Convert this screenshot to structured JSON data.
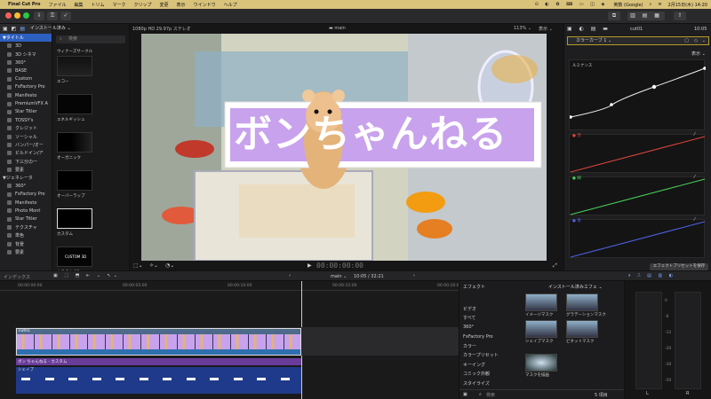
{
  "menubar": {
    "app": "Final Cut Pro",
    "items": [
      "ファイル",
      "編集",
      "トリム",
      "マーク",
      "クリップ",
      "変更",
      "表示",
      "ウインドウ",
      "ヘルプ"
    ],
    "right": {
      "input": "英数 (Google)",
      "datetime": "2月15日(木)  14:20"
    }
  },
  "sidebar": {
    "header": "インストール済み ⌄",
    "items": [
      {
        "label": "タイトル",
        "level": 0,
        "selected": true
      },
      {
        "label": "3D",
        "level": 1
      },
      {
        "label": "3D シネマ",
        "level": 1
      },
      {
        "label": "360°",
        "level": 1
      },
      {
        "label": "BASE",
        "level": 1
      },
      {
        "label": "Custom",
        "level": 1
      },
      {
        "label": "FxFactory Pro",
        "level": 1
      },
      {
        "label": "Manifesto",
        "level": 1
      },
      {
        "label": "PremiumVFX A",
        "level": 1
      },
      {
        "label": "Star Titler",
        "level": 1
      },
      {
        "label": "TOSSY's",
        "level": 1
      },
      {
        "label": "クレジット",
        "level": 1
      },
      {
        "label": "ソーシャル",
        "level": 1
      },
      {
        "label": "バンパー/オー",
        "level": 1
      },
      {
        "label": "ビルドイン/ア",
        "level": 1
      },
      {
        "label": "下三分の一",
        "level": 1
      },
      {
        "label": "要素",
        "level": 1
      },
      {
        "label": "ジェネレータ",
        "level": 0
      },
      {
        "label": "360°",
        "level": 1
      },
      {
        "label": "FxFactory Pro",
        "level": 1
      },
      {
        "label": "Manifesto",
        "level": 1
      },
      {
        "label": "Photo Mont",
        "level": 1
      },
      {
        "label": "Star Titler",
        "level": 1
      },
      {
        "label": "テクスチャ",
        "level": 1
      },
      {
        "label": "単色",
        "level": 1
      },
      {
        "label": "背景",
        "level": 1
      },
      {
        "label": "要素",
        "level": 1
      }
    ]
  },
  "browser": {
    "search_placeholder": "検索",
    "top_label": "ウィナーズサークル",
    "items": [
      {
        "label": "エコー",
        "thumb": "echo"
      },
      {
        "label": "エネルギッシュ",
        "thumb": "black"
      },
      {
        "label": "オーガニック",
        "thumb": "organic"
      },
      {
        "label": "オーバーラップ",
        "thumb": "overlap"
      },
      {
        "label": "カスタム",
        "thumb": "custom",
        "selected": true
      },
      {
        "label": "カスタム 3D",
        "thumb": "custom3d",
        "thumb_text": "CUSTOM 3D"
      }
    ]
  },
  "viewer": {
    "format": "1080p HD 29.97p ステレオ",
    "project": "main",
    "zoom": "113% ⌄",
    "view_menu": "表示 ⌄",
    "title_text": "ボンちゃんねる",
    "timecode": "00:00:00:00",
    "play_icon": "play-icon"
  },
  "inspector": {
    "clip": "cut01",
    "duration": "10:05",
    "effect": "カラーカーブ 1 ⌄",
    "view_menu": "表示 ⌄",
    "luma_label": "ルミナンス",
    "channels": [
      {
        "name": "赤",
        "color": "#e0453a"
      },
      {
        "name": "緑",
        "color": "#4bd25a"
      },
      {
        "name": "青",
        "color": "#4f64e6"
      }
    ],
    "save_button": "エフェクトプリセットを保存"
  },
  "timeline_header": {
    "index": "インデックス",
    "project": "main ⌄",
    "position": "10:05 / 32:21"
  },
  "timeline": {
    "ruler": [
      "00:00:00:00",
      "00:00:05:00",
      "00:00:10:00",
      "00:00:15:00",
      "00:00:20:00"
    ],
    "video_clip": "cut01",
    "title_clip": "ボン ちゃんねる - カスタム",
    "shape_clip": "シェイプ"
  },
  "effects": {
    "header": "エフェクト",
    "installed": "インストール済みエフェ ⌄",
    "categories": [
      "ビデオ",
      "すべて",
      "360°",
      "FxFactory Pro",
      "カラー",
      "カラープリセット",
      "キーイング",
      "コミック外観",
      "スタイライズ"
    ],
    "items": [
      {
        "label": "イメージマスク"
      },
      {
        "label": "グラデーションマスク"
      },
      {
        "label": "シェイプマスク"
      },
      {
        "label": "ビネットマスク"
      },
      {
        "label": "マスクを描画"
      }
    ],
    "search_placeholder": "検索",
    "count": "5 項目"
  },
  "meters": {
    "scale": [
      "0",
      "-6",
      "-12",
      "-20",
      "-30",
      "-50"
    ],
    "channels": [
      "L",
      "R"
    ]
  }
}
